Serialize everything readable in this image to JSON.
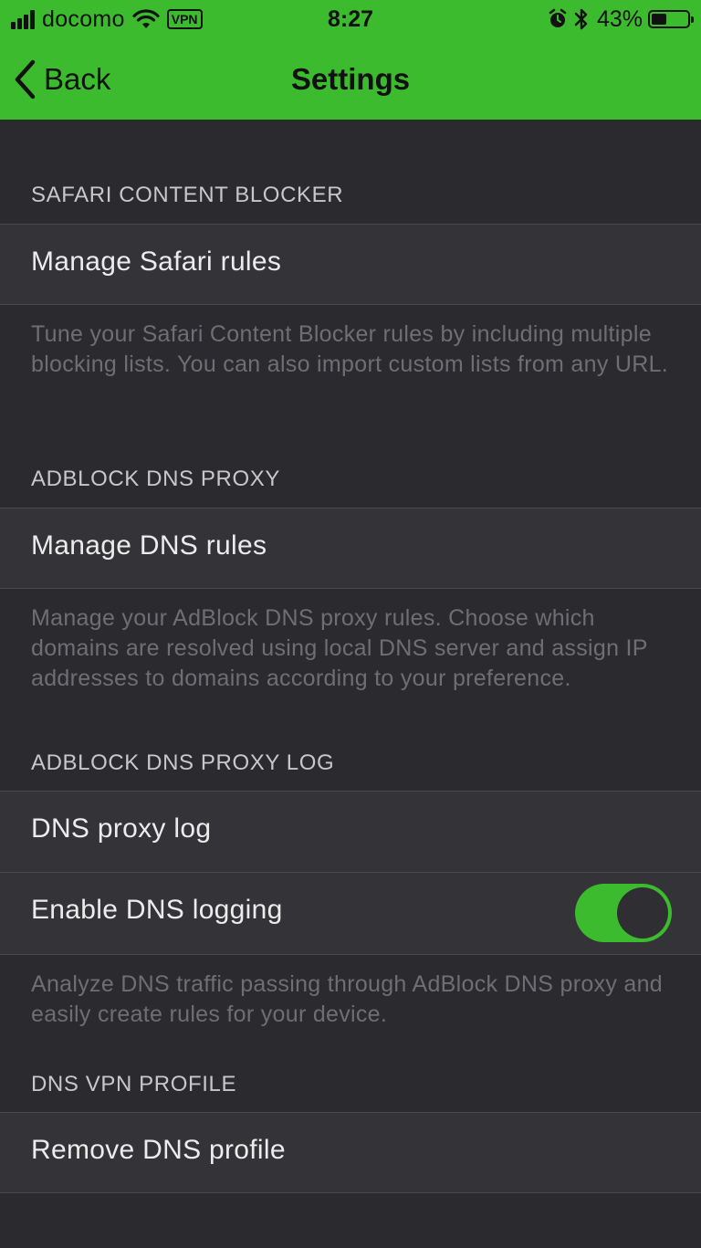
{
  "status_bar": {
    "carrier": "docomo",
    "vpn": "VPN",
    "time": "8:27",
    "battery_percent": "43%",
    "battery_level": 0.43,
    "icons": [
      "signal-icon",
      "wifi-icon",
      "alarm-icon",
      "bluetooth-icon",
      "battery-icon"
    ]
  },
  "nav": {
    "back_label": "Back",
    "title": "Settings"
  },
  "sections": {
    "safari": {
      "header": "SAFARI CONTENT BLOCKER",
      "row": "Manage Safari rules",
      "footer": "Tune your Safari Content Blocker rules by including multiple blocking lists. You can also import custom lists from any URL."
    },
    "dns_proxy": {
      "header": "ADBLOCK DNS PROXY",
      "row": "Manage DNS rules",
      "footer": "Manage your AdBlock DNS proxy rules. Choose which domains are resolved using local DNS server and assign IP addresses to domains according to your preference."
    },
    "dns_log": {
      "header": "ADBLOCK DNS PROXY LOG",
      "row_log": "DNS proxy log",
      "row_enable": "Enable DNS logging",
      "enable_logging_on": true,
      "footer": "Analyze DNS traffic passing through AdBlock DNS proxy and easily create rules for your device."
    },
    "vpn_profile": {
      "header": "DNS VPN PROFILE",
      "row": "Remove DNS profile"
    }
  },
  "colors": {
    "accent": "#3dbb2f",
    "background": "#2a2a2f",
    "cell": "#333338",
    "footer_text": "#6e6e73"
  }
}
